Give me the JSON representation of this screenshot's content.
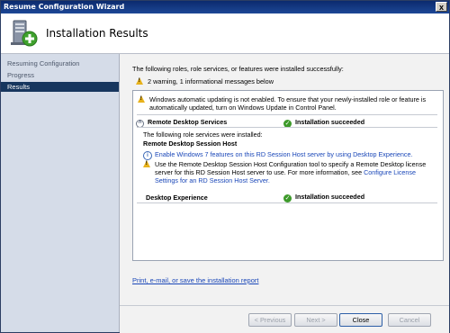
{
  "window": {
    "title": "Resume Configuration Wizard",
    "close_glyph": "x"
  },
  "header": {
    "title": "Installation Results",
    "icon": "server-with-plus-icon"
  },
  "sidebar": {
    "items": [
      {
        "label": "Resuming Configuration",
        "active": false
      },
      {
        "label": "Progress",
        "active": false
      },
      {
        "label": "Results",
        "active": true
      }
    ]
  },
  "content": {
    "intro": "The following roles, role services, or features were installed successfully:",
    "summary": "2 warning, 1 informational messages below",
    "update_warning_line1": "Windows automatic updating is not enabled. To ensure that your newly-installed role or feature is",
    "update_warning_line2": "automatically updated, turn on Windows Update in Control Panel.",
    "rds": {
      "name": "Remote Desktop Services",
      "status": "Installation succeeded",
      "services_intro": "The following role services were installed:",
      "service_name": "Remote Desktop Session Host",
      "info_link": "Enable Windows 7 features on this RD Session Host server by using Desktop Experience.",
      "config_line1": "Use the Remote Desktop Session Host Configuration tool to specify a Remote Desktop license",
      "config_line2_prefix": "server for this RD Session Host server to use. For more information, see ",
      "config_link_part1": "Configure License",
      "config_link_part2": "Settings for an RD Session Host Server."
    },
    "desktop": {
      "name": "Desktop Experience",
      "status": "Installation succeeded"
    },
    "report_link": "Print, e-mail, or save the installation report"
  },
  "buttons": {
    "previous": "< Previous",
    "next": "Next >",
    "close": "Close",
    "cancel": "Cancel"
  },
  "colors": {
    "selected_nav": "#17365e",
    "success_green": "#3d9a2a",
    "warning_yellow": "#e8b21b",
    "link_blue": "#1a47b8"
  }
}
